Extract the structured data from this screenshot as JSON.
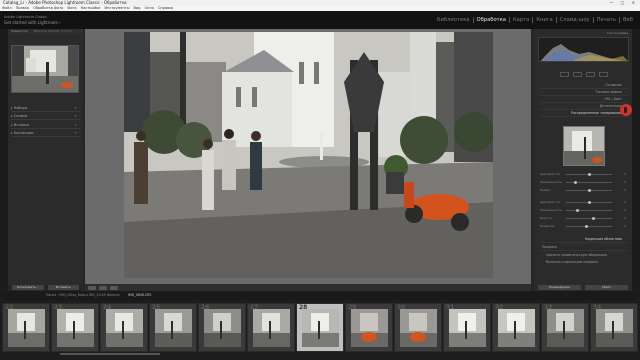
{
  "window": {
    "title": "Catalog_Lr - Adobe Photoshop Lightroom Classic - Обработка",
    "controls": "— ▢ ✕"
  },
  "menu": [
    "Файл",
    "Правка",
    "Обработка фото",
    "Фото",
    "Настройки",
    "Инструменты",
    "Вид",
    "Окно",
    "Справка"
  ],
  "identity": {
    "line1": "Adobe Lightroom Classic",
    "line2": "Get started with Lightroom ›"
  },
  "modules": {
    "items": [
      "Библиотека",
      "Обработка",
      "Карта",
      "Книга",
      "Слайд-шоу",
      "Печать",
      "Веб"
    ],
    "active_index": 1
  },
  "left_panel": {
    "navigator": {
      "header": "Навигатор",
      "modes": "Вписать  Заполн.  1:1  3:1"
    },
    "sections": [
      "Наборы",
      "Снимки",
      "История",
      "Коллекции"
    ],
    "buttons": {
      "copy": "Копировать...",
      "paste": "Вставить"
    }
  },
  "right_panel": {
    "histogram_label": "Гистограмма",
    "rows": [
      "Основные",
      "Тоновая кривая",
      "HSL / Цвет",
      "Детализация"
    ],
    "section_header": "Распределенное тонирование",
    "sliders": [
      {
        "label": "Цветовой тон",
        "value": "0",
        "level": 0.5
      },
      {
        "label": "Насыщенность",
        "value": "0",
        "level": 0.2
      },
      {
        "label": "Баланс",
        "value": "0",
        "level": 0.5
      },
      {
        "label": "Цветовой тон",
        "value": "0",
        "level": 0.5
      },
      {
        "label": "Насыщенность",
        "value": "0",
        "level": 0.25
      },
      {
        "label": "Яркость",
        "value": "0",
        "level": 0.6
      },
      {
        "label": "Размытие",
        "value": "0",
        "level": 0.45
      }
    ],
    "lens_header": "Коррекция объектива",
    "lens_tab": "Профиль",
    "lens_options": [
      "Удалить хроматическую аберрацию",
      "Включить коррекцию профиля"
    ],
    "buttons": {
      "previous": "Предыдущие",
      "reset": "Сброс"
    }
  },
  "filmstrip_bar": {
    "text": "Папка : IMG_Ulitsa_Koloru   IMG_20-29   Фильтр:",
    "filename": "IMG_0846.CR3"
  },
  "filmstrip": {
    "numbers": [
      "22",
      "23",
      "24",
      "25",
      "26",
      "27",
      "28",
      "29",
      "30",
      "31",
      "32",
      "33",
      "34"
    ],
    "selected_index": 6
  },
  "colors": {
    "accent_red": "#d3312b",
    "active_module": "#e6e6e6"
  }
}
